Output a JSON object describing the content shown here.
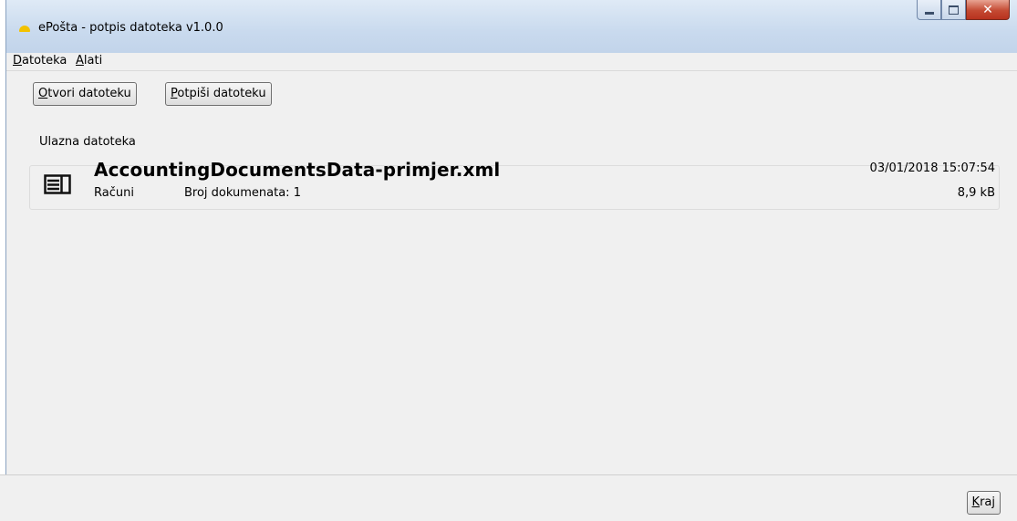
{
  "window": {
    "title": "ePošta - potpis datoteka v1.0.0",
    "controls": {
      "minimize": "minimize",
      "maximize": "maximize",
      "close": "close"
    }
  },
  "menu": {
    "items": [
      {
        "acc": "D",
        "rest": "atoteka"
      },
      {
        "acc": "A",
        "rest": "lati"
      }
    ]
  },
  "toolbar": {
    "open": {
      "acc": "O",
      "rest": "tvori datoteku"
    },
    "sign": {
      "acc": "P",
      "rest": "otpiši datoteku"
    }
  },
  "input_file": {
    "group_label": "Ulazna datoteka",
    "icon": "document-list-icon",
    "name": "AccountingDocumentsData-primjer.xml",
    "type": "Računi",
    "count_text": "Broj dokumenata: 1",
    "date": "03/01/2018 15:07:54",
    "size": "8,9 kB"
  },
  "footer": {
    "close": {
      "acc": "K",
      "rest": "raj"
    }
  },
  "colors": {
    "accent_icon": "#f2c200",
    "close_button": "#c44a33"
  }
}
